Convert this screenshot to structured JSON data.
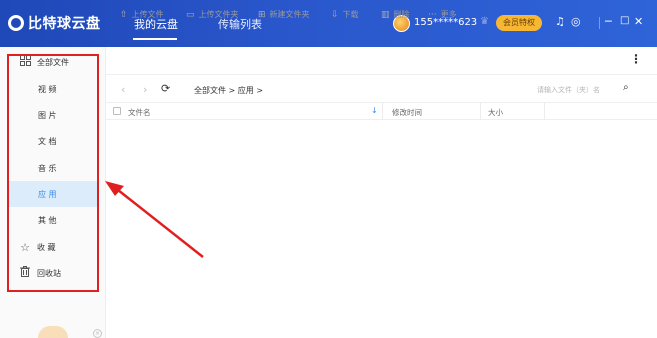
{
  "app": {
    "logo_text": "比特球云盘",
    "nav": [
      {
        "label": "我的云盘"
      },
      {
        "label": "传输列表"
      }
    ],
    "username": "155*****623",
    "vip_label": "会员特权"
  },
  "sidebar": {
    "items": [
      {
        "label": "全部文件",
        "icon": "grid-icon"
      },
      {
        "label": "视 频"
      },
      {
        "label": "图 片"
      },
      {
        "label": "文 档"
      },
      {
        "label": "音 乐"
      },
      {
        "label": "应 用"
      },
      {
        "label": "其 他"
      },
      {
        "label": "收 藏",
        "icon": "star-icon"
      },
      {
        "label": "回收站",
        "icon": "trash-icon"
      }
    ],
    "active_index": 5
  },
  "toolbar": {
    "upload_file": "上传文件",
    "upload_folder": "上传文件夹",
    "new_folder": "新建文件夹",
    "download": "下载",
    "delete": "删除",
    "more": "更多"
  },
  "pathbar": {
    "breadcrumb": "全部文件 > 应用 >",
    "search_placeholder": "请输入文件（夹）名"
  },
  "table": {
    "columns": [
      "文件名",
      "修改时间",
      "大小"
    ]
  },
  "colors": {
    "header_bg": "#2a57cc",
    "accent": "#3a8ee6",
    "annotation": "#e02020",
    "vip": "#f7b733"
  }
}
